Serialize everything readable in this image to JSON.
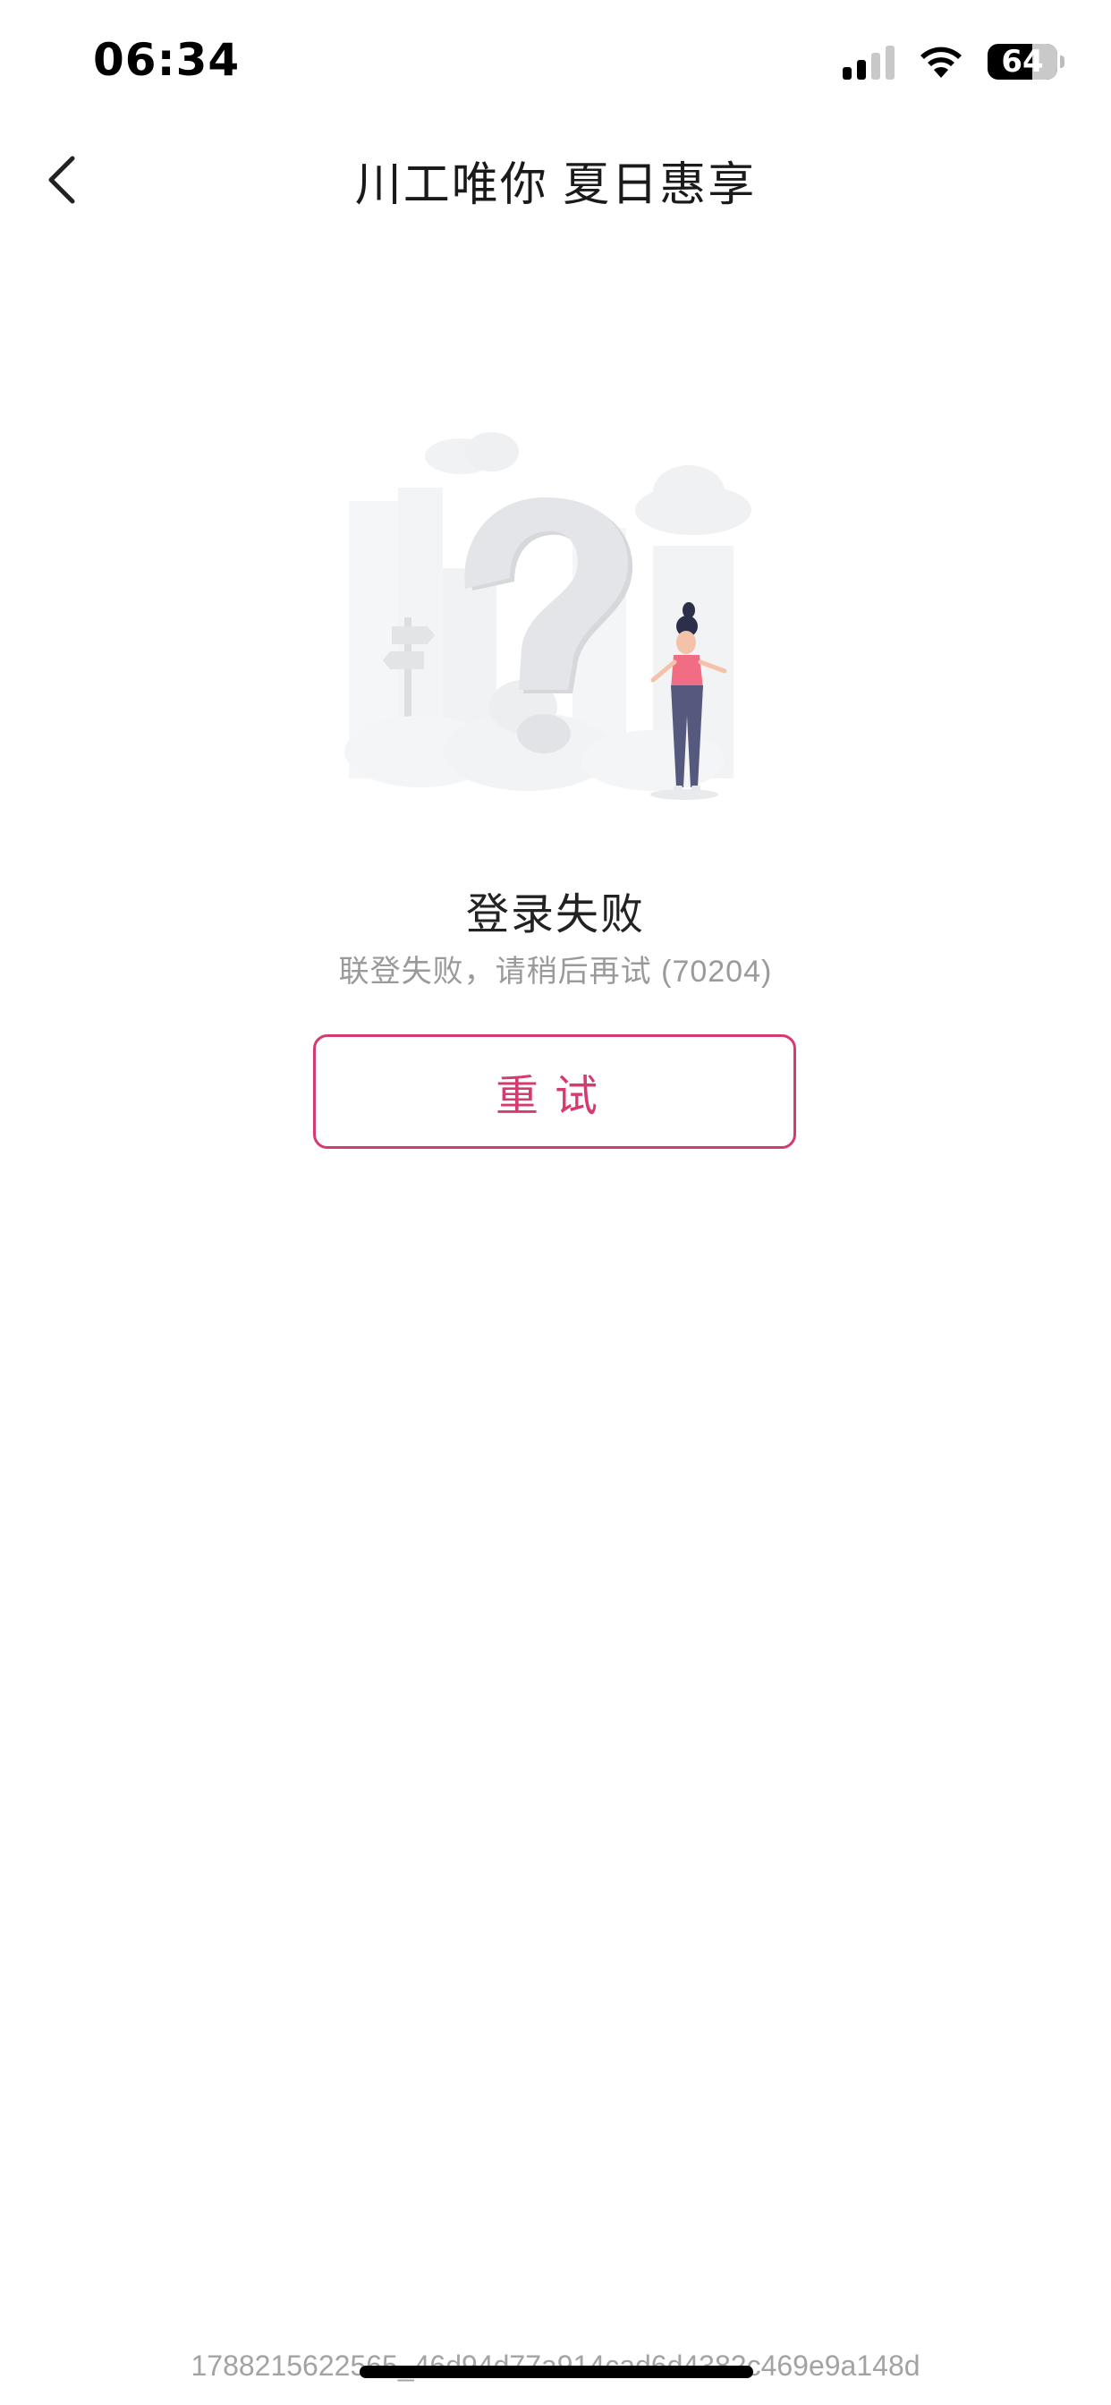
{
  "status_bar": {
    "time": "06:34",
    "battery_level": "64",
    "battery_percent": 64,
    "signal_bars_active": 2,
    "signal_bars_total": 4,
    "icons": [
      "signal-icon",
      "wifi-icon",
      "battery-icon"
    ]
  },
  "nav": {
    "back_icon": "chevron-left-icon",
    "title": "川工唯你 夏日惠享"
  },
  "error": {
    "illustration": "question-mark-person-illustration",
    "title": "登录失败",
    "message": "联登失败，请稍后再试 (70204)"
  },
  "actions": {
    "retry_label": "重试"
  },
  "footer": {
    "trace_id": "1788215622565_46d94d77a914cad6d4382c469e9a148d"
  },
  "colors": {
    "accent": "#d63b6e",
    "text_primary": "#222222",
    "text_secondary": "#9a9a9a"
  }
}
